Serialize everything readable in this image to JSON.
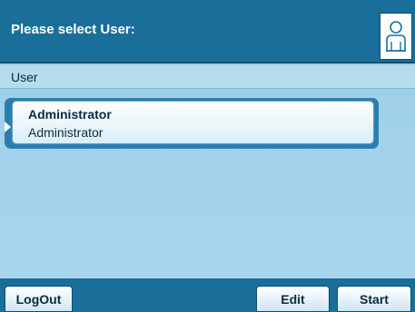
{
  "header": {
    "title": "Please select User:",
    "icon": "user-icon"
  },
  "subheader": {
    "label": "User"
  },
  "users": [
    {
      "name": "Administrator",
      "role": "Administrator",
      "selected": true
    }
  ],
  "footer": {
    "logout": "LogOut",
    "edit": "Edit",
    "start": "Start"
  },
  "colors": {
    "header": "#1a6f9a",
    "background": "#9fd0ea",
    "selection_frame": "#2b7fb0"
  }
}
